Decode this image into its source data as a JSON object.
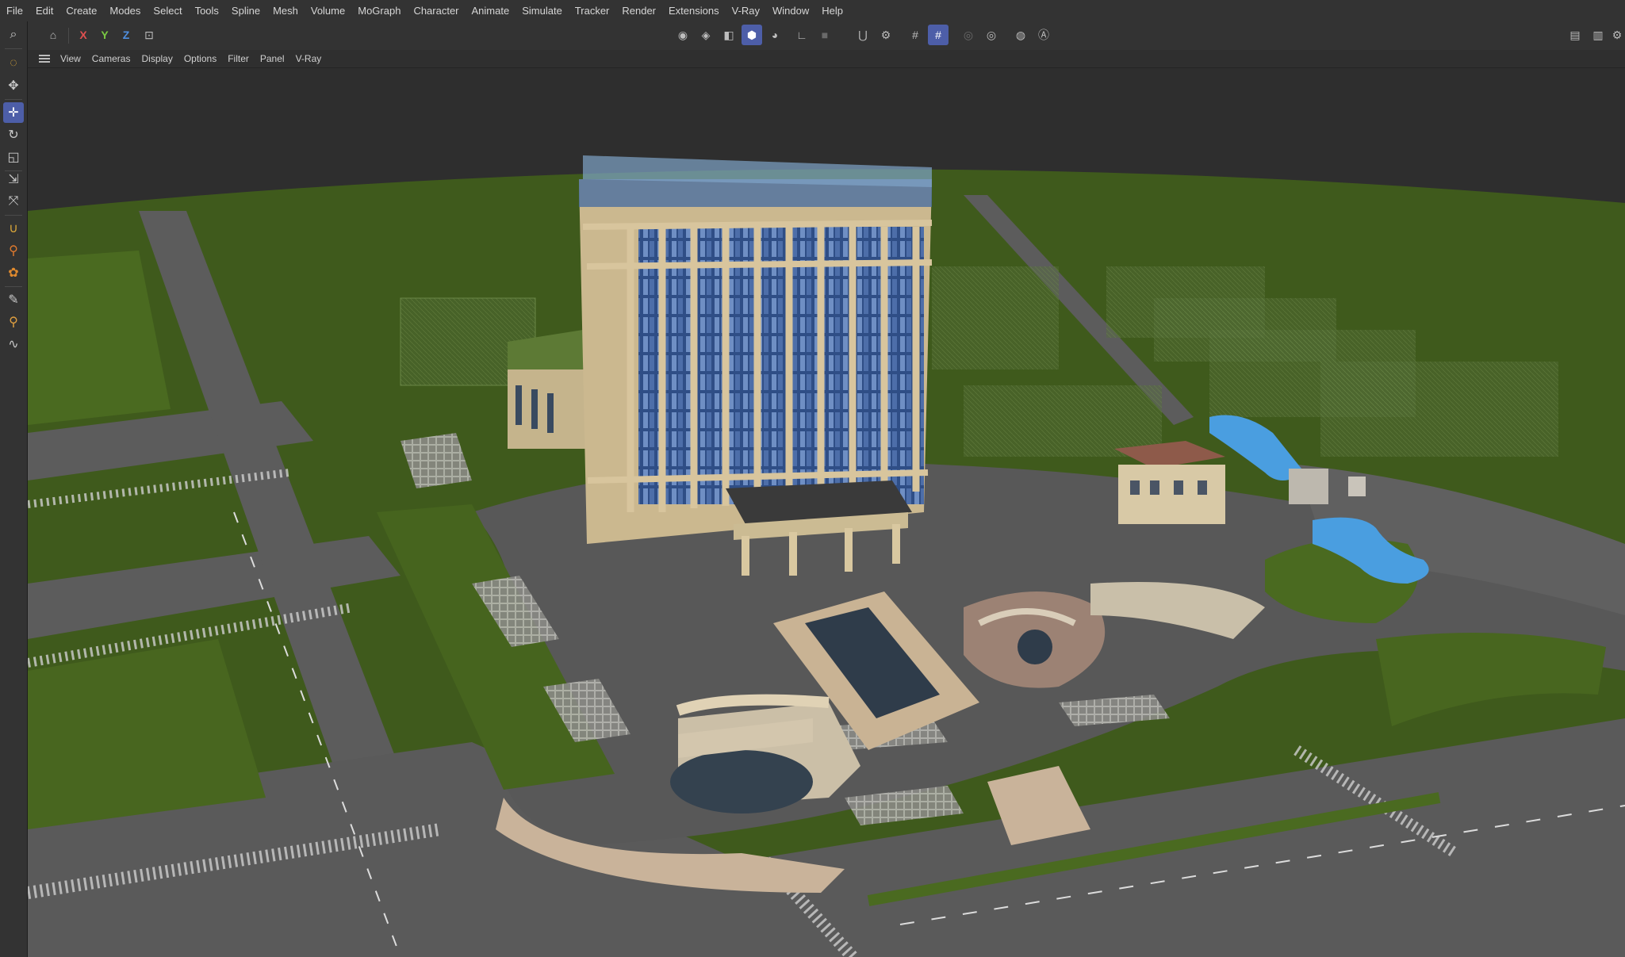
{
  "menu": {
    "items": [
      "File",
      "Edit",
      "Create",
      "Modes",
      "Select",
      "Tools",
      "Spline",
      "Mesh",
      "Volume",
      "MoGraph",
      "Character",
      "Animate",
      "Simulate",
      "Tracker",
      "Render",
      "Extensions",
      "V-Ray",
      "Window",
      "Help"
    ]
  },
  "toolbar": {
    "axis_x": "X",
    "axis_y": "Y",
    "axis_z": "Z"
  },
  "viewport_menu": {
    "items": [
      "View",
      "Cameras",
      "Display",
      "Options",
      "Filter",
      "Panel",
      "V-Ray"
    ]
  },
  "colors": {
    "accent": "#4d5ea8",
    "axis_x": "#e05050",
    "axis_y": "#7ac943",
    "axis_z": "#4f8fe0",
    "grass": "#3f5a1c",
    "road": "#5c5c5c",
    "sky": "#2e2e2e"
  },
  "icons": {
    "left_tools": [
      "search-icon",
      "live-selection-icon",
      "object-tool-icon",
      "move-icon",
      "rotate-icon",
      "scale-icon",
      "transform-icon",
      "snap-icon",
      "magnet-icon",
      "paint-icon",
      "brush-icon",
      "sculpt-icon",
      "pen-icon",
      "knife-icon",
      "spline-pen-icon"
    ],
    "toolbar": [
      "undo-icon",
      "axis-lock-icon",
      "points-mode-icon",
      "edges-mode-icon",
      "polygons-mode-icon",
      "model-mode-icon",
      "texture-mode-icon",
      "workplane-icon",
      "snap-icon",
      "quantize-icon",
      "grid-icon",
      "grid-snap-icon",
      "render-view-icon",
      "render-icon",
      "interactive-render-icon",
      "vray-icon"
    ]
  }
}
